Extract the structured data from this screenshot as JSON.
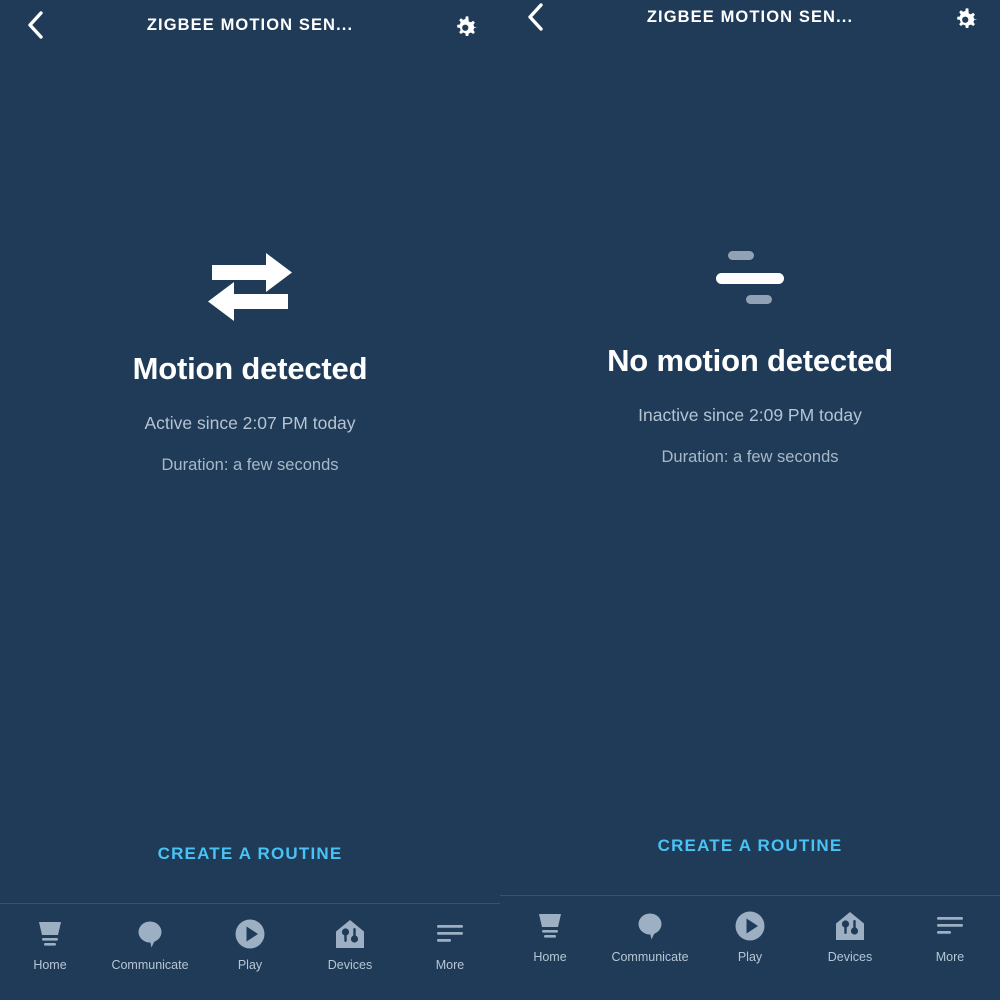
{
  "theme": {
    "background": "#1f3b58",
    "accent_link": "#49c3f5",
    "primary_text": "#ffffff",
    "secondary_text": "#b6c4d2",
    "nav_icon": "#9db0c3",
    "nav_divider": "#35536f",
    "muted_bar": "#90a2b4"
  },
  "panels": [
    {
      "header": {
        "back_icon": "chevron-left-icon",
        "title": "ZIGBEE MOTION SEN...",
        "settings_icon": "gear-icon"
      },
      "status": {
        "icon": "motion-arrows-icon",
        "title": "Motion detected",
        "since": "Active since 2:07 PM today",
        "duration": "Duration: a few seconds"
      },
      "routine_label": "CREATE A ROUTINE",
      "nav": [
        {
          "icon": "home-lamp-icon",
          "label": "Home"
        },
        {
          "icon": "speech-bubble-icon",
          "label": "Communicate"
        },
        {
          "icon": "play-circle-icon",
          "label": "Play"
        },
        {
          "icon": "devices-house-icon",
          "label": "Devices"
        },
        {
          "icon": "more-lines-icon",
          "label": "More"
        }
      ]
    },
    {
      "header": {
        "back_icon": "chevron-left-icon",
        "title": "ZIGBEE MOTION SEN...",
        "settings_icon": "gear-icon"
      },
      "status": {
        "icon": "no-motion-bars-icon",
        "title": "No motion detected",
        "since": "Inactive since 2:09 PM today",
        "duration": "Duration: a few seconds"
      },
      "routine_label": "CREATE A ROUTINE",
      "nav": [
        {
          "icon": "home-lamp-icon",
          "label": "Home"
        },
        {
          "icon": "speech-bubble-icon",
          "label": "Communicate"
        },
        {
          "icon": "play-circle-icon",
          "label": "Play"
        },
        {
          "icon": "devices-house-icon",
          "label": "Devices"
        },
        {
          "icon": "more-lines-icon",
          "label": "More"
        }
      ]
    }
  ]
}
